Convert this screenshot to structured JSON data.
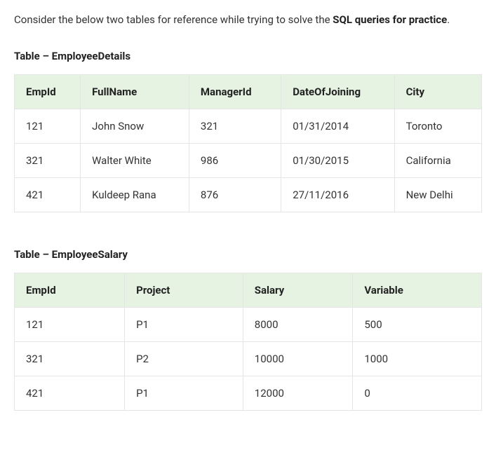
{
  "intro": {
    "text_before": "Consider the below two tables for reference while trying to solve the ",
    "bold_text": "SQL queries for practice",
    "text_after": "."
  },
  "table1": {
    "title": "Table – EmployeeDetails",
    "headers": [
      "EmpId",
      "FullName",
      "ManagerId",
      "DateOfJoining",
      "City"
    ],
    "rows": [
      [
        "121",
        "John Snow",
        "321",
        "01/31/2014",
        "Toronto"
      ],
      [
        "321",
        "Walter White",
        "986",
        "01/30/2015",
        "California"
      ],
      [
        "421",
        "Kuldeep Rana",
        "876",
        "27/11/2016",
        "New Delhi"
      ]
    ]
  },
  "table2": {
    "title": "Table – EmployeeSalary",
    "headers": [
      "EmpId",
      "Project",
      "Salary",
      "Variable"
    ],
    "rows": [
      [
        "121",
        "P1",
        "8000",
        "500"
      ],
      [
        "321",
        "P2",
        "10000",
        "1000"
      ],
      [
        "421",
        "P1",
        "12000",
        "0"
      ]
    ]
  }
}
